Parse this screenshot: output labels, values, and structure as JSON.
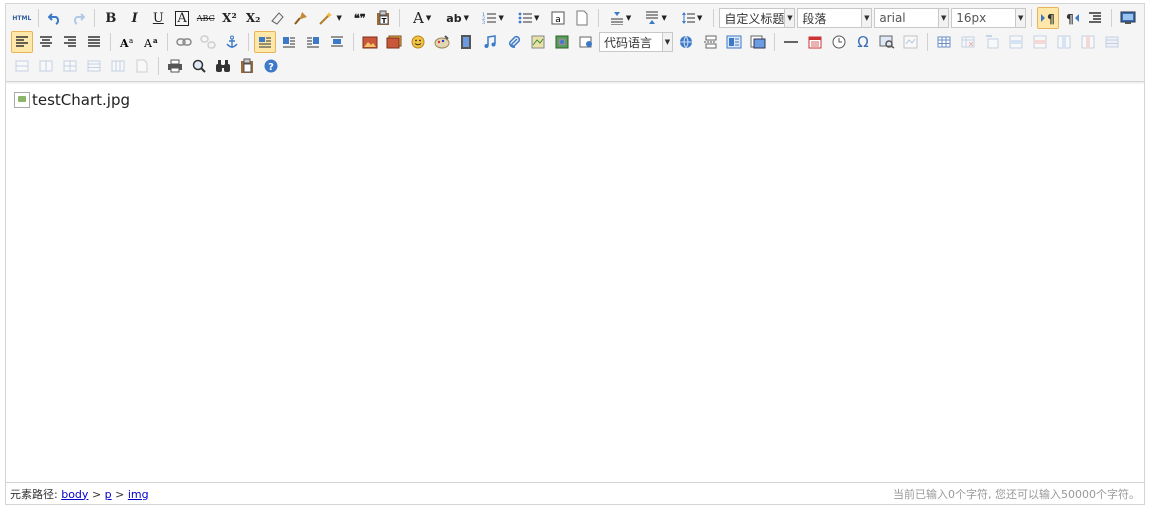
{
  "toolbar": {
    "row1": {
      "html_label": "HTML",
      "bold": "B",
      "italic": "I",
      "underline": "U",
      "fontborder": "A",
      "strike": "ABC",
      "superscript": "X²",
      "subscript": "X₂",
      "quote": "❝❞",
      "forecolor": "A",
      "backcolor": "ab",
      "custom_style": "自定义标题",
      "paragraph": "段落",
      "font_family": "arial",
      "font_size": "16px"
    },
    "row2": {
      "code_language": "代码语言"
    },
    "colors": {
      "accent": "#fde7a9",
      "accent_border": "#e8b45a",
      "toolbar_bg": "#f5f5f5"
    }
  },
  "content": {
    "image_alt": "testChart.jpg"
  },
  "statusbar": {
    "path_label": "元素路径:",
    "path": [
      "body",
      "p",
      "img"
    ],
    "separator": ">",
    "count_text": "当前已输入0个字符, 您还可以输入50000个字符。"
  }
}
